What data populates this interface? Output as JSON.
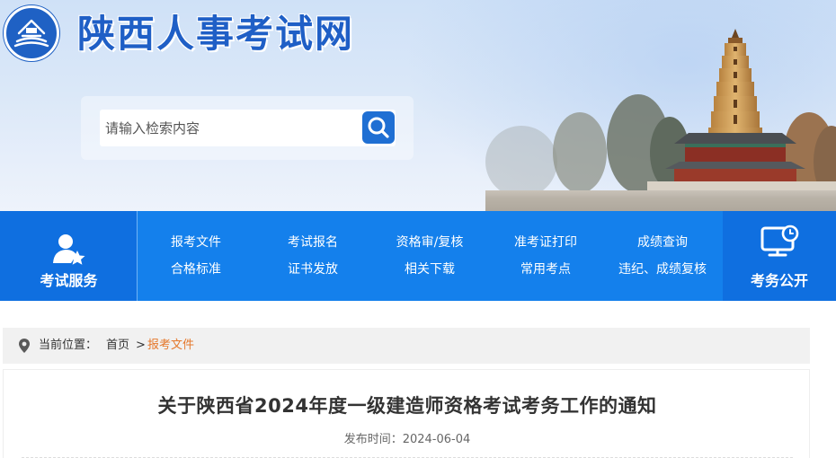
{
  "header": {
    "site_title": "陕西人事考试网",
    "search_placeholder": "请输入检索内容"
  },
  "nav": {
    "left_section": "考试服务",
    "right_section": "考务公开",
    "links_row1": [
      "报考文件",
      "考试报名",
      "资格审/复核",
      "准考证打印",
      "成绩查询"
    ],
    "links_row2": [
      "合格标准",
      "证书发放",
      "相关下载",
      "常用考点",
      "违纪、成绩复核"
    ]
  },
  "breadcrumb": {
    "label": "当前位置：",
    "home": "首页",
    "separator": ">",
    "current": "报考文件"
  },
  "article": {
    "title": "关于陕西省2024年度一级建造师资格考试考务工作的通知",
    "meta_label": "发布时间：",
    "date": "2024-06-04"
  },
  "colors": {
    "brand_blue": "#1f5fc6",
    "nav_blue": "#1480ec",
    "nav_dark": "#0f6fe0",
    "breadcrumb_active": "#e5782b"
  },
  "icons": [
    "logo-emblem",
    "search-icon",
    "user-service-icon",
    "monitor-icon",
    "location-pin-icon"
  ]
}
